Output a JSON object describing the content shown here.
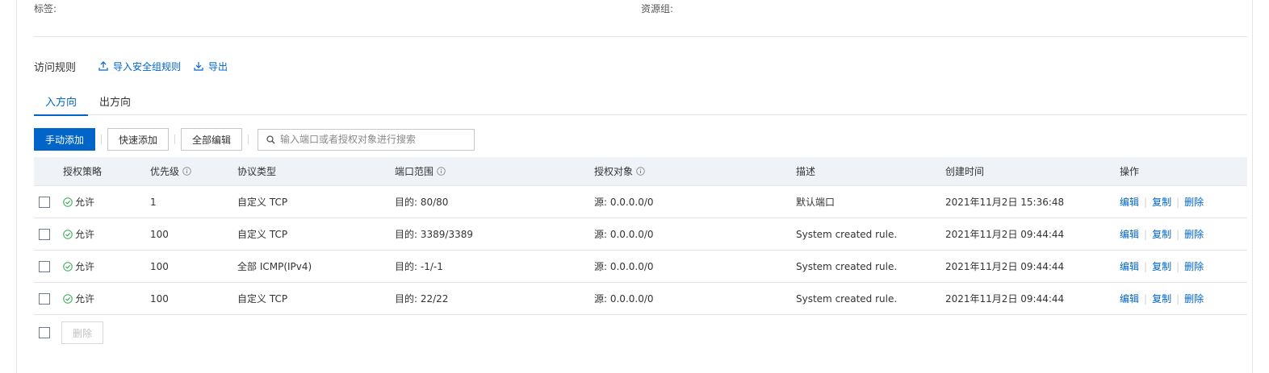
{
  "meta": {
    "tags_label": "标签:",
    "resource_group_label": "资源组:"
  },
  "rules": {
    "title": "访问规则",
    "import_label": "导入安全组规则",
    "export_label": "导出"
  },
  "tabs": [
    {
      "label": "入方向",
      "active": true
    },
    {
      "label": "出方向",
      "active": false
    }
  ],
  "toolbar": {
    "manual_add": "手动添加",
    "quick_add": "快速添加",
    "edit_all": "全部编辑",
    "search_placeholder": "输入端口或者授权对象进行搜索"
  },
  "table": {
    "headers": {
      "policy": "授权策略",
      "priority": "优先级",
      "protocol": "协议类型",
      "port": "端口范围",
      "auth": "授权对象",
      "desc": "描述",
      "time": "创建时间",
      "ops": "操作"
    },
    "rows": [
      {
        "policy": "允许",
        "priority": "1",
        "protocol": "自定义 TCP",
        "port": "目的: 80/80",
        "auth": "源: 0.0.0.0/0",
        "desc": "默认端口",
        "time": "2021年11月2日 15:36:48"
      },
      {
        "policy": "允许",
        "priority": "100",
        "protocol": "自定义 TCP",
        "port": "目的: 3389/3389",
        "auth": "源: 0.0.0.0/0",
        "desc": "System created rule.",
        "time": "2021年11月2日 09:44:44"
      },
      {
        "policy": "允许",
        "priority": "100",
        "protocol": "全部 ICMP(IPv4)",
        "port": "目的: -1/-1",
        "auth": "源: 0.0.0.0/0",
        "desc": "System created rule.",
        "time": "2021年11月2日 09:44:44"
      },
      {
        "policy": "允许",
        "priority": "100",
        "protocol": "自定义 TCP",
        "port": "目的: 22/22",
        "auth": "源: 0.0.0.0/0",
        "desc": "System created rule.",
        "time": "2021年11月2日 09:44:44"
      }
    ],
    "ops": {
      "edit": "编辑",
      "copy": "复制",
      "delete": "删除"
    }
  },
  "bottom": {
    "delete_label": "删除"
  },
  "colors": {
    "accent": "#0064c8",
    "allow_green": "#2fa84f",
    "header_bg": "#eff3f8"
  }
}
